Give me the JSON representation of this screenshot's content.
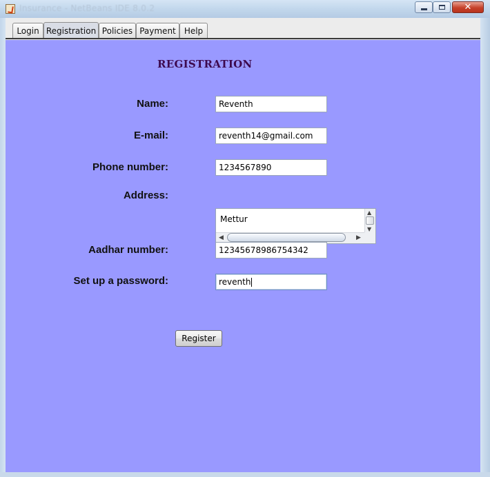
{
  "window": {
    "title": "Insurance - NetBeans IDE 8.0.2",
    "close_glyph": "✕"
  },
  "tabs": [
    {
      "label": "Login",
      "active": false
    },
    {
      "label": "Registration",
      "active": true
    },
    {
      "label": "Policies",
      "active": false
    },
    {
      "label": "Payment",
      "active": false
    },
    {
      "label": "Help",
      "active": false
    }
  ],
  "form": {
    "heading": "REGISTRATION",
    "name_label": "Name:",
    "name_value": "Reventh",
    "email_label": "E-mail:",
    "email_value": "reventh14@gmail.com",
    "phone_label": "Phone number:",
    "phone_value": "1234567890",
    "address_label": "Address:",
    "address_value": "Mettur",
    "aadhar_label": "Aadhar number:",
    "aadhar_value": "12345678986754342",
    "password_label": "Set up a password:",
    "password_value": "reventh",
    "register_label": "Register"
  },
  "colors": {
    "panel_background": "#9999ff",
    "heading_color": "#3d0a4e"
  },
  "icons": {
    "app": "java-app-icon",
    "minimize": "minimize-icon",
    "maximize": "maximize-icon",
    "close": "close-icon"
  }
}
